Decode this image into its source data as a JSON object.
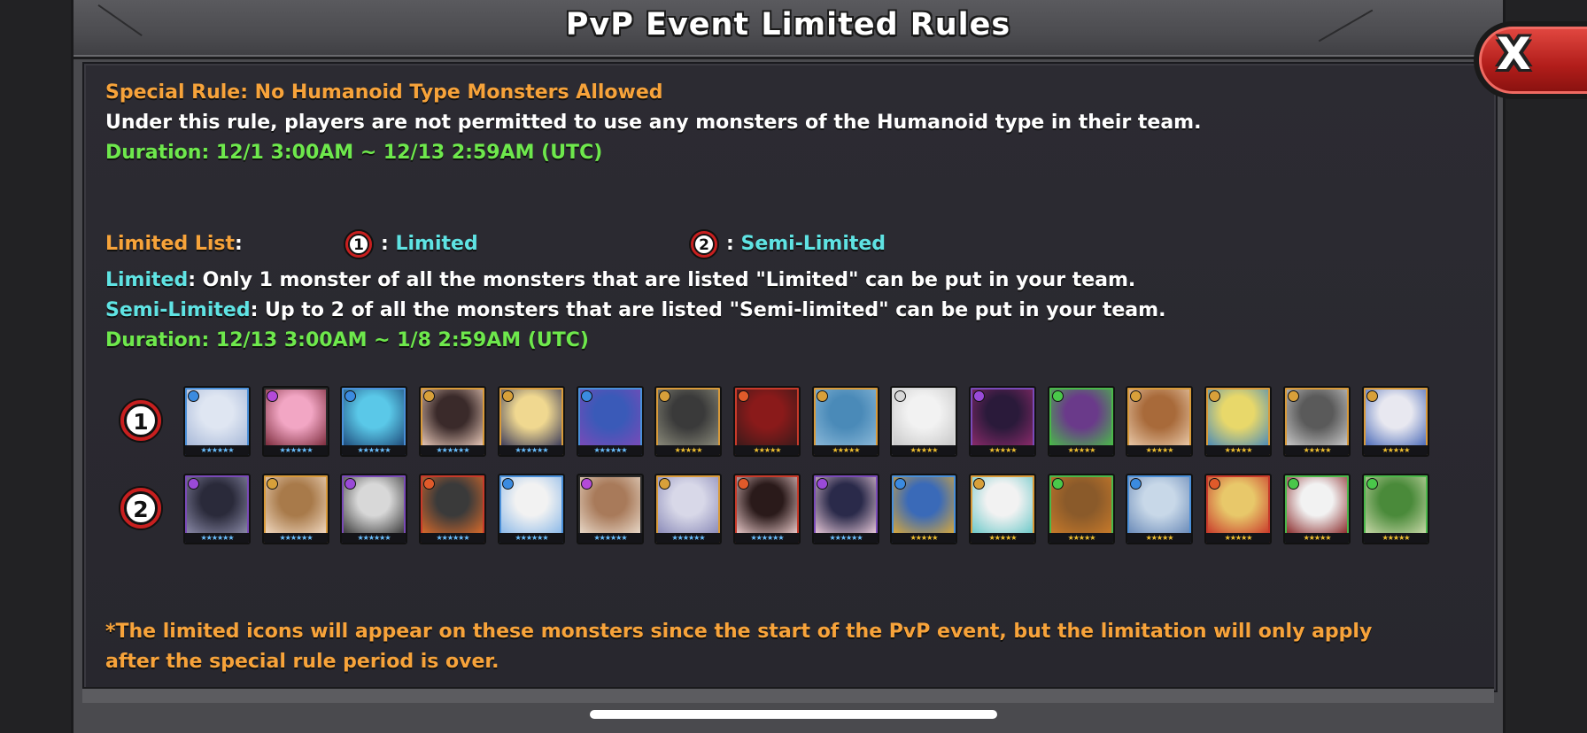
{
  "header": {
    "title": "PvP Event Limited Rules",
    "close_label": "X"
  },
  "special_rule": {
    "heading": "Special Rule: No Humanoid Type Monsters Allowed",
    "description": "Under this rule, players are not permitted to use any monsters of the Humanoid type in their team.",
    "duration": "Duration: 12/1 3:00AM ~ 12/13 2:59AM (UTC)"
  },
  "limited_list": {
    "label": "Limited List",
    "colon": ":",
    "legend": [
      {
        "badge": "1",
        "sep": ":",
        "text": "Limited"
      },
      {
        "badge": "2",
        "sep": ":",
        "text": "Semi-Limited"
      }
    ],
    "limited_term": "Limited",
    "limited_desc": ": Only 1 monster of all the monsters that are listed \"Limited\" can be put in your team.",
    "semi_term": "Semi-Limited",
    "semi_desc": ": Up to 2 of all the monsters that are listed \"Semi-limited\" can be put in your team.",
    "duration": "Duration: 12/13 3:00AM ~ 1/8 2:59AM (UTC)"
  },
  "rows": [
    {
      "badge": "1",
      "monsters": [
        {
          "icon": "monster-portrait",
          "frame": "#4a8fd8",
          "art": [
            "#dfe6f2",
            "#a7b8d8"
          ],
          "orb": "#3b8be0",
          "stars": "★★★★★★",
          "star_color": "#6ac0ff"
        },
        {
          "icon": "monster-portrait",
          "frame": "#2a2a2a",
          "art": [
            "#f2a6c4",
            "#7a2a3a"
          ],
          "orb": "#b44ad8",
          "stars": "★★★★★★",
          "star_color": "#6ac0ff"
        },
        {
          "icon": "monster-portrait",
          "frame": "#4a8fd8",
          "art": [
            "#5ac8e8",
            "#1e4a7a"
          ],
          "orb": "#3b8be0",
          "stars": "★★★★★★",
          "star_color": "#6ac0ff"
        },
        {
          "icon": "monster-portrait",
          "frame": "#d89a3a",
          "art": [
            "#3a2a2a",
            "#e8c8b8"
          ],
          "orb": "#d8a03a",
          "stars": "★★★★★★",
          "star_color": "#6ac0ff"
        },
        {
          "icon": "monster-portrait",
          "frame": "#d89a3a",
          "art": [
            "#f0d890",
            "#3a3a5a"
          ],
          "orb": "#d8a03a",
          "stars": "★★★★★★",
          "star_color": "#6ac0ff"
        },
        {
          "icon": "monster-portrait",
          "frame": "#4a8fd8",
          "art": [
            "#3a5ab8",
            "#7a4ab8"
          ],
          "orb": "#3b8be0",
          "stars": "★★★★★★",
          "star_color": "#6ac0ff"
        },
        {
          "icon": "monster-portrait",
          "frame": "#d89a3a",
          "art": [
            "#3a3a3a",
            "#8a8a7a"
          ],
          "orb": "#d8a03a",
          "stars": "★★★★★",
          "star_color": "#f0c030"
        },
        {
          "icon": "monster-portrait",
          "frame": "#c83a2a",
          "art": [
            "#8a1a1a",
            "#3a1a1a"
          ],
          "orb": "#e05a2a",
          "stars": "★★★★★",
          "star_color": "#f0c030"
        },
        {
          "icon": "monster-portrait",
          "frame": "#d89a3a",
          "art": [
            "#4a8ab8",
            "#8ab8d8"
          ],
          "orb": "#d8a03a",
          "stars": "★★★★★",
          "star_color": "#f0c030"
        },
        {
          "icon": "monster-portrait",
          "frame": "#d8d8d8",
          "art": [
            "#f2f2f2",
            "#c8c8c8"
          ],
          "orb": "#d8d8d8",
          "stars": "★★★★★",
          "star_color": "#f0c030"
        },
        {
          "icon": "monster-portrait",
          "frame": "#7a4ab8",
          "art": [
            "#2a1a3a",
            "#8a2a6a"
          ],
          "orb": "#9a4ad8",
          "stars": "★★★★★",
          "star_color": "#f0c030"
        },
        {
          "icon": "monster-portrait",
          "frame": "#4ab84a",
          "art": [
            "#6a3a8a",
            "#4ab84a"
          ],
          "orb": "#4ac84a",
          "stars": "★★★★★",
          "star_color": "#f0c030"
        },
        {
          "icon": "monster-portrait",
          "frame": "#d89a3a",
          "art": [
            "#a86a3a",
            "#e8c8a8"
          ],
          "orb": "#d8a03a",
          "stars": "★★★★★",
          "star_color": "#f0c030"
        },
        {
          "icon": "monster-portrait",
          "frame": "#d89a3a",
          "art": [
            "#e8d86a",
            "#4a8ab8"
          ],
          "orb": "#d8a03a",
          "stars": "★★★★★",
          "star_color": "#f0c030"
        },
        {
          "icon": "monster-portrait",
          "frame": "#d89a3a",
          "art": [
            "#5a5a5a",
            "#c8c8c8"
          ],
          "orb": "#d8a03a",
          "stars": "★★★★★",
          "star_color": "#f0c030"
        },
        {
          "icon": "monster-portrait",
          "frame": "#d89a3a",
          "art": [
            "#e8e8f0",
            "#4a6ab8"
          ],
          "orb": "#d8a03a",
          "stars": "★★★★★",
          "star_color": "#f0c030"
        }
      ]
    },
    {
      "badge": "2",
      "monsters": [
        {
          "icon": "monster-portrait",
          "frame": "#7a4ab8",
          "art": [
            "#2a2a3a",
            "#8a8aa8"
          ],
          "orb": "#9a4ad8",
          "stars": "★★★★★★",
          "star_color": "#6ac0ff"
        },
        {
          "icon": "monster-portrait",
          "frame": "#d89a3a",
          "art": [
            "#a87a4a",
            "#f0d8c0"
          ],
          "orb": "#d8a03a",
          "stars": "★★★★★★",
          "star_color": "#6ac0ff"
        },
        {
          "icon": "monster-portrait",
          "frame": "#7a4ab8",
          "art": [
            "#d8d8d8",
            "#3a3a3a"
          ],
          "orb": "#9a4ad8",
          "stars": "★★★★★★",
          "star_color": "#6ac0ff"
        },
        {
          "icon": "monster-portrait",
          "frame": "#c83a2a",
          "art": [
            "#3a3a3a",
            "#d86a2a"
          ],
          "orb": "#e05a2a",
          "stars": "★★★★★★",
          "star_color": "#6ac0ff"
        },
        {
          "icon": "monster-portrait",
          "frame": "#4a8fd8",
          "art": [
            "#f2f2f2",
            "#8ab8e8"
          ],
          "orb": "#3b8be0",
          "stars": "★★★★★★",
          "star_color": "#6ac0ff"
        },
        {
          "icon": "monster-portrait",
          "frame": "#2a2a2a",
          "art": [
            "#a87a5a",
            "#e8d8c8"
          ],
          "orb": "#b44ad8",
          "stars": "★★★★★★",
          "star_color": "#6ac0ff"
        },
        {
          "icon": "monster-portrait",
          "frame": "#d89a3a",
          "art": [
            "#d8d8e8",
            "#8a8ab8"
          ],
          "orb": "#d8a03a",
          "stars": "★★★★★★",
          "star_color": "#6ac0ff"
        },
        {
          "icon": "monster-portrait",
          "frame": "#c83a2a",
          "art": [
            "#2a1a1a",
            "#e8c8c8"
          ],
          "orb": "#e05a2a",
          "stars": "★★★★★★",
          "star_color": "#6ac0ff"
        },
        {
          "icon": "monster-portrait",
          "frame": "#7a4ab8",
          "art": [
            "#2a2a4a",
            "#e8c8d8"
          ],
          "orb": "#9a4ad8",
          "stars": "★★★★★★",
          "star_color": "#6ac0ff"
        },
        {
          "icon": "monster-portrait",
          "frame": "#4a8fd8",
          "art": [
            "#3a6ab8",
            "#d8a83a"
          ],
          "orb": "#3b8be0",
          "stars": "★★★★★",
          "star_color": "#f0c030"
        },
        {
          "icon": "monster-portrait",
          "frame": "#d89a3a",
          "art": [
            "#f2f2f2",
            "#6ac8c8"
          ],
          "orb": "#d8a03a",
          "stars": "★★★★★",
          "star_color": "#f0c030"
        },
        {
          "icon": "monster-portrait",
          "frame": "#4ab84a",
          "art": [
            "#8a5a2a",
            "#c87a2a"
          ],
          "orb": "#4ac84a",
          "stars": "★★★★★",
          "star_color": "#f0c030"
        },
        {
          "icon": "monster-portrait",
          "frame": "#4a8fd8",
          "art": [
            "#c8d8e8",
            "#6a8ab8"
          ],
          "orb": "#3b8be0",
          "stars": "★★★★★",
          "star_color": "#f0c030"
        },
        {
          "icon": "monster-portrait",
          "frame": "#c83a2a",
          "art": [
            "#e8c86a",
            "#c83a2a"
          ],
          "orb": "#e05a2a",
          "stars": "★★★★★",
          "star_color": "#f0c030"
        },
        {
          "icon": "monster-portrait",
          "frame": "#4ab84a",
          "art": [
            "#f2f2f2",
            "#8a2a2a"
          ],
          "orb": "#4ac84a",
          "stars": "★★★★★",
          "star_color": "#f0c030"
        },
        {
          "icon": "monster-portrait",
          "frame": "#4ab84a",
          "art": [
            "#4a8a3a",
            "#c8d8a8"
          ],
          "orb": "#4ac84a",
          "stars": "★★★★★",
          "star_color": "#f0c030"
        }
      ]
    }
  ],
  "footnote": {
    "line1": "*The limited icons will appear on these monsters since the start of the PvP event, but the limitation will only apply",
    "line2": "after the special rule period is over."
  },
  "colors": {
    "orange": "#f7a33a",
    "green": "#6ee84c",
    "cyan": "#5fe3e3",
    "badge_red": "#c81f1f"
  }
}
